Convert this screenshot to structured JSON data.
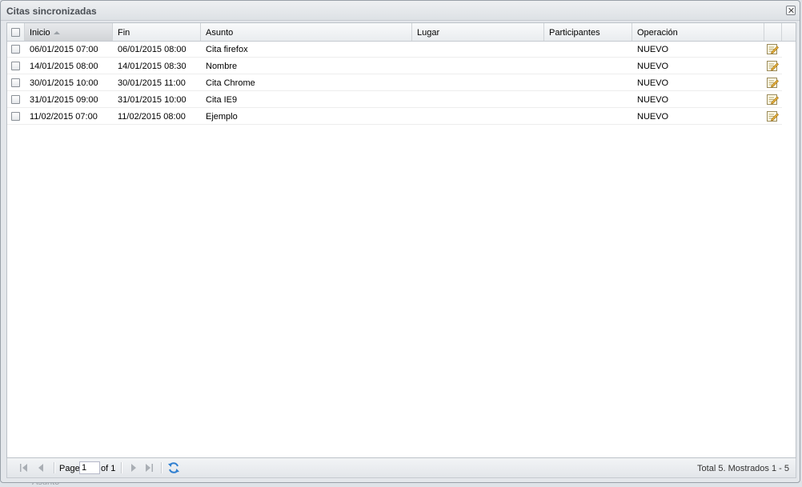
{
  "window": {
    "title": "Citas sincronizadas"
  },
  "grid": {
    "columns": [
      {
        "key": "inicio",
        "label": "Inicio",
        "sorted": "asc"
      },
      {
        "key": "fin",
        "label": "Fin"
      },
      {
        "key": "asunto",
        "label": "Asunto"
      },
      {
        "key": "lugar",
        "label": "Lugar"
      },
      {
        "key": "participantes",
        "label": "Participantes"
      },
      {
        "key": "operacion",
        "label": "Operación"
      }
    ],
    "rows": [
      {
        "inicio": "06/01/2015 07:00",
        "fin": "06/01/2015 08:00",
        "asunto": "Cita firefox",
        "lugar": "",
        "participantes": "",
        "operacion": "NUEVO"
      },
      {
        "inicio": "14/01/2015 08:00",
        "fin": "14/01/2015 08:30",
        "asunto": "Nombre",
        "lugar": "",
        "participantes": "",
        "operacion": "NUEVO"
      },
      {
        "inicio": "30/01/2015 10:00",
        "fin": "30/01/2015 11:00",
        "asunto": "Cita Chrome",
        "lugar": "",
        "participantes": "",
        "operacion": "NUEVO"
      },
      {
        "inicio": "31/01/2015 09:00",
        "fin": "31/01/2015 10:00",
        "asunto": "Cita IE9",
        "lugar": "",
        "participantes": "",
        "operacion": "NUEVO"
      },
      {
        "inicio": "11/02/2015 07:00",
        "fin": "11/02/2015 08:00",
        "asunto": "Ejemplo",
        "lugar": "",
        "participantes": "",
        "operacion": "NUEVO"
      }
    ]
  },
  "paging": {
    "page_label": "Page",
    "page_value": "1",
    "of_label": "of 1",
    "status": "Total 5. Mostrados 1 - 5"
  },
  "background": {
    "partial_label": "Asunto"
  },
  "colors": {
    "accent_refresh": "#2f7fd0",
    "edit_icon": "#d9a93a"
  }
}
